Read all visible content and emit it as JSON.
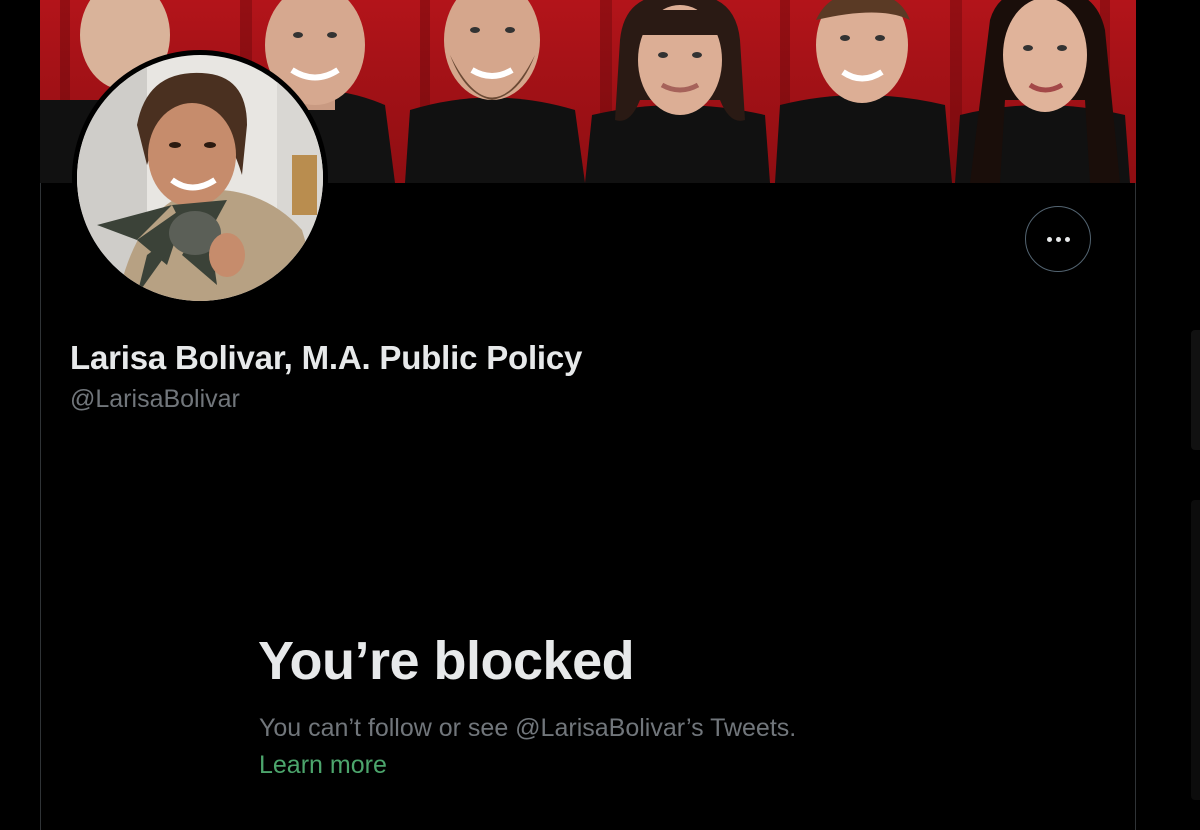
{
  "profile": {
    "display_name": "Larisa Bolivar, M.A. Public Policy",
    "handle": "@LarisaBolivar",
    "banner_description_icon": "banner-photo",
    "avatar_icon": "avatar-photo"
  },
  "actions": {
    "more_icon": "ellipsis-icon"
  },
  "blocked": {
    "title": "You’re blocked",
    "description": "You can’t follow or see @LarisaBolivar’s Tweets.",
    "learn_more": "Learn more"
  },
  "colors": {
    "background": "#000000",
    "primary_text": "#e7e9ea",
    "secondary_text": "#71767b",
    "link": "#4ca56c",
    "border": "#2f3336",
    "banner_red": "#b3141a"
  }
}
